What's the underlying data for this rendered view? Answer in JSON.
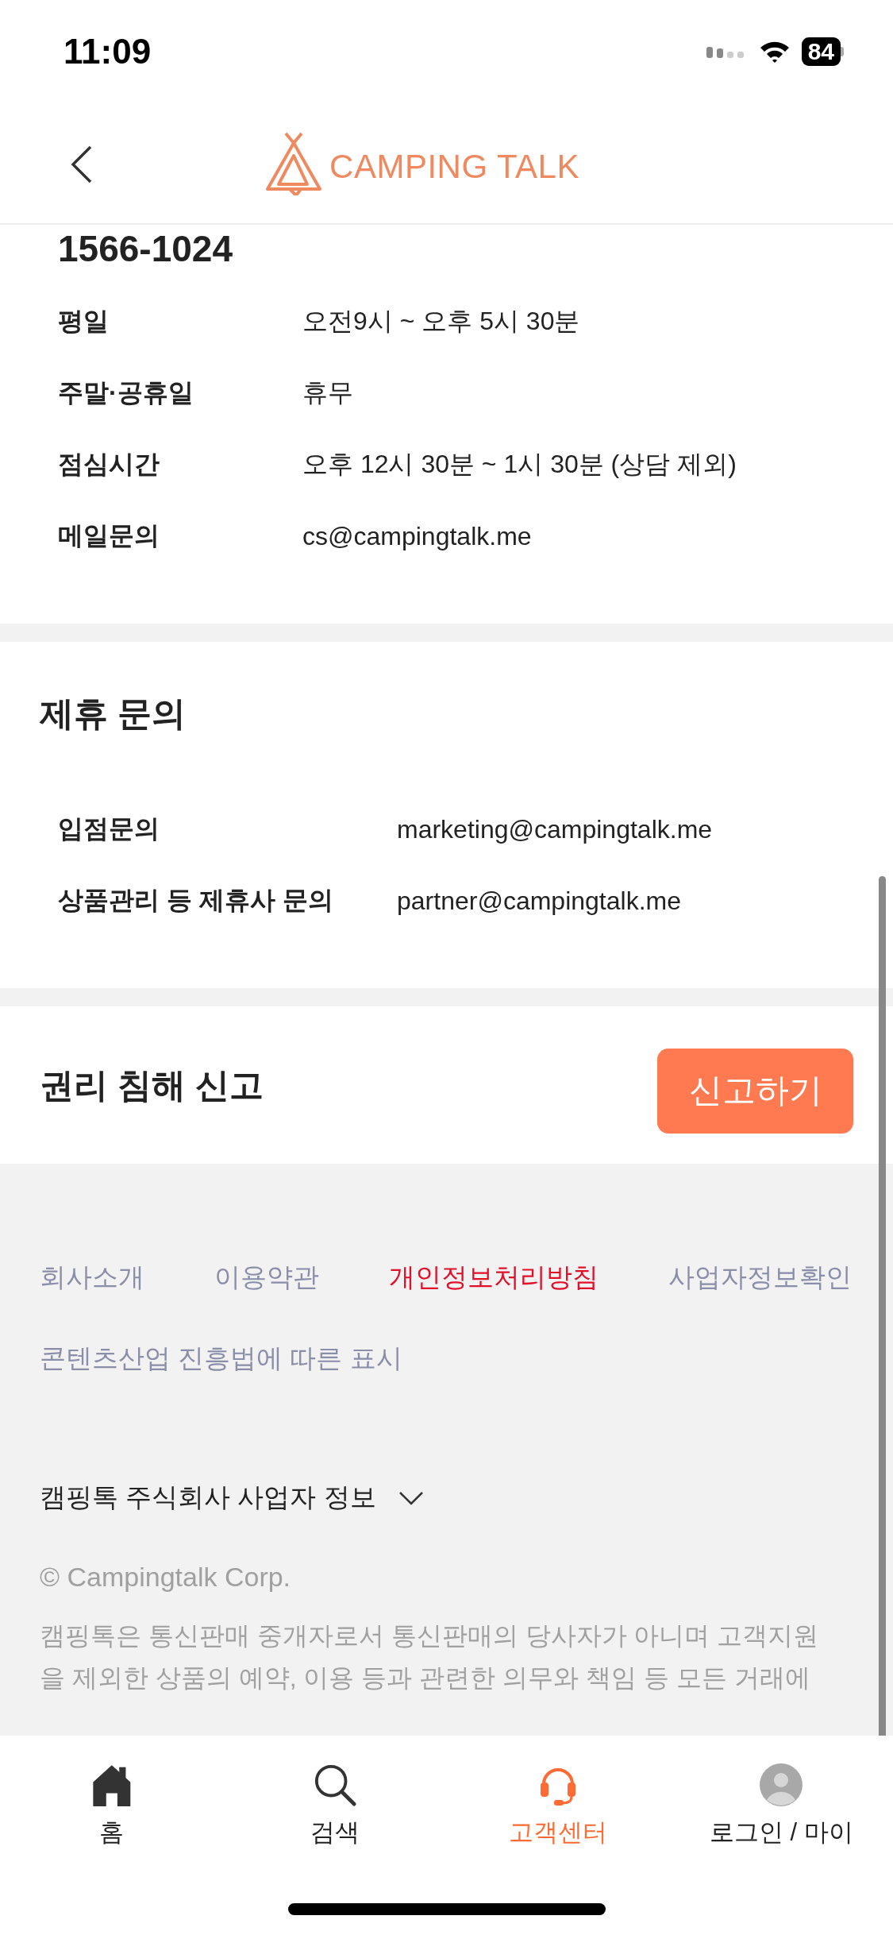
{
  "status_bar": {
    "time": "11:09",
    "battery": "84"
  },
  "header": {
    "logo_text": "CAMPING TALK"
  },
  "contact": {
    "phone": "1566-1024",
    "rows": [
      {
        "label": "평일",
        "value": "오전9시 ~ 오후 5시 30분"
      },
      {
        "label": "주말·공휴일",
        "value": "휴무"
      },
      {
        "label": "점심시간",
        "value": "오후 12시 30분 ~ 1시 30분 (상담 제외)"
      },
      {
        "label": "메일문의",
        "value": "cs@campingtalk.me"
      }
    ]
  },
  "partnership": {
    "title": "제휴 문의",
    "rows": [
      {
        "label": "입점문의",
        "value": "marketing@campingtalk.me"
      },
      {
        "label": "상품관리 등 제휴사 문의",
        "value": "partner@campingtalk.me"
      }
    ]
  },
  "rights_report": {
    "title": "권리 침해 신고",
    "button": "신고하기"
  },
  "footer": {
    "links": [
      {
        "label": "회사소개",
        "highlighted": false
      },
      {
        "label": "이용약관",
        "highlighted": false
      },
      {
        "label": "개인정보처리방침",
        "highlighted": true
      },
      {
        "label": "사업자정보확인",
        "highlighted": false
      },
      {
        "label": "콘텐츠산업 진흥법에 따른 표시",
        "highlighted": false
      }
    ],
    "business_info": {
      "label": "캠핑톡 주식회사 사업자 정보",
      "expanded": false
    },
    "copyright": "© Campingtalk Corp.",
    "disclaimer_lines": [
      "캠핑톡은 통신판매 중개자로서 통신판매의 당사자가 아니며 고객지원",
      "을 제외한 상품의 예약, 이용 등과 관련한 의무와 책임 등 모든 거래에"
    ]
  },
  "tab_bar": [
    {
      "label": "홈",
      "kind": "home",
      "selected": false
    },
    {
      "label": "검색",
      "kind": "search",
      "selected": false
    },
    {
      "label": "고객센터",
      "kind": "support",
      "selected": true
    },
    {
      "label": "로그인 / 마이",
      "kind": "account",
      "selected": false
    }
  ]
}
